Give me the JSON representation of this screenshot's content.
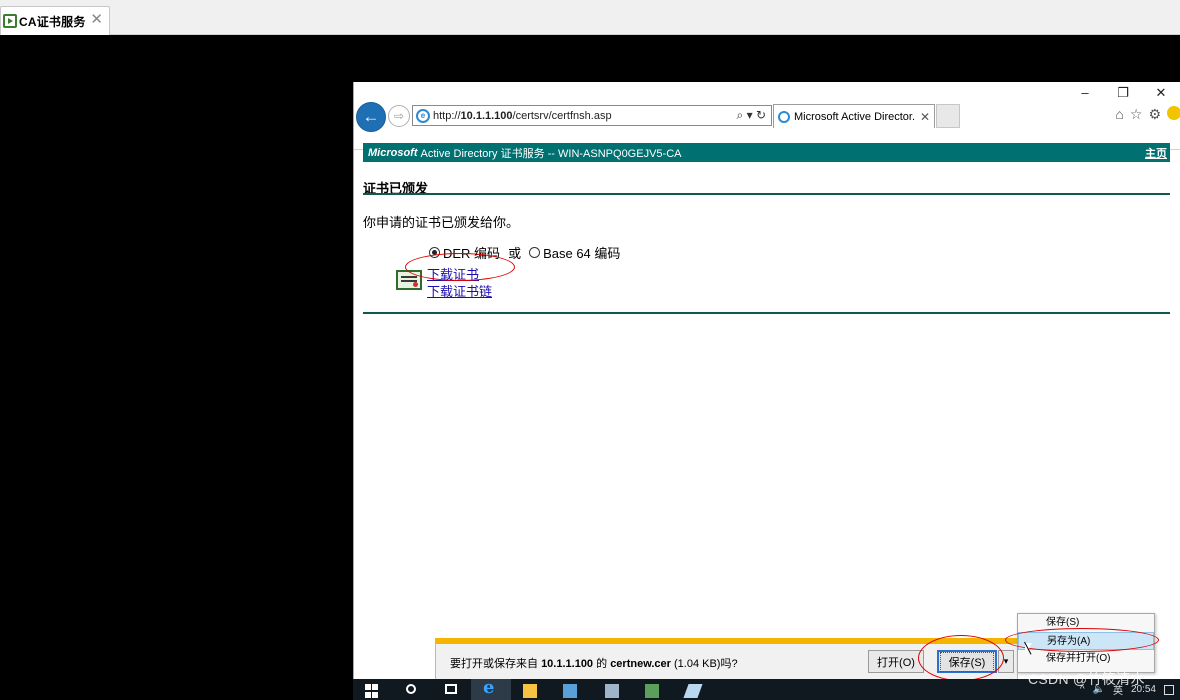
{
  "host_tab": {
    "title": "CA证书服务",
    "close": "✕"
  },
  "window_controls": {
    "minimize": "–",
    "restore": "❐",
    "close": "✕"
  },
  "ie": {
    "address_prefix": "http://",
    "address_host": "10.1.1.100",
    "address_path": "/certsrv/certfnsh.asp",
    "address_tools": "⌕ ▾ ↻",
    "tab_title": "Microsoft Active Director...",
    "tab_close": "✕",
    "right_icons": {
      "home": "⌂",
      "favorites": "☆",
      "settings": "⚙"
    }
  },
  "page": {
    "header_brand": "Microsoft",
    "header_text": "Active Directory 证书服务  --  WIN-ASNPQ0GEJV5-CA",
    "home_link": "主页",
    "heading": "证书已颁发",
    "issued_message": "你申请的证书已颁发给你。",
    "encoding": {
      "der_label": "DER 编码",
      "or_label": "或",
      "base64_label": "Base 64 编码",
      "selected": "DER 编码"
    },
    "download_cert_link": "下载证书",
    "download_chain_link": "下载证书链"
  },
  "download_bar": {
    "prompt_before": "要打开或保存来自 ",
    "host": "10.1.1.100",
    "prompt_middle": " 的 ",
    "filename": "certnew.cer",
    "prompt_after": " (1.04 KB)吗?",
    "open_button": "打开(O)",
    "save_button": "保存(S)",
    "arrow": "▾"
  },
  "save_menu": {
    "items": [
      {
        "label": "保存(S)"
      },
      {
        "label": "另存为(A)"
      },
      {
        "label": "保存并打开(O)"
      }
    ],
    "highlighted": "另存为(A)"
  },
  "taskbar": {
    "tray_caret": "^",
    "tray_volume": "🔈",
    "tray_lang": "英",
    "clock": "20:54"
  },
  "watermark": "CSDN @竹筱清水",
  "colors": {
    "header_teal": "#007070",
    "rule_teal": "#0d5a52",
    "ie_blue": "#1f6fb5",
    "download_accent": "#f4b400",
    "annotation_red": "#e00000"
  }
}
